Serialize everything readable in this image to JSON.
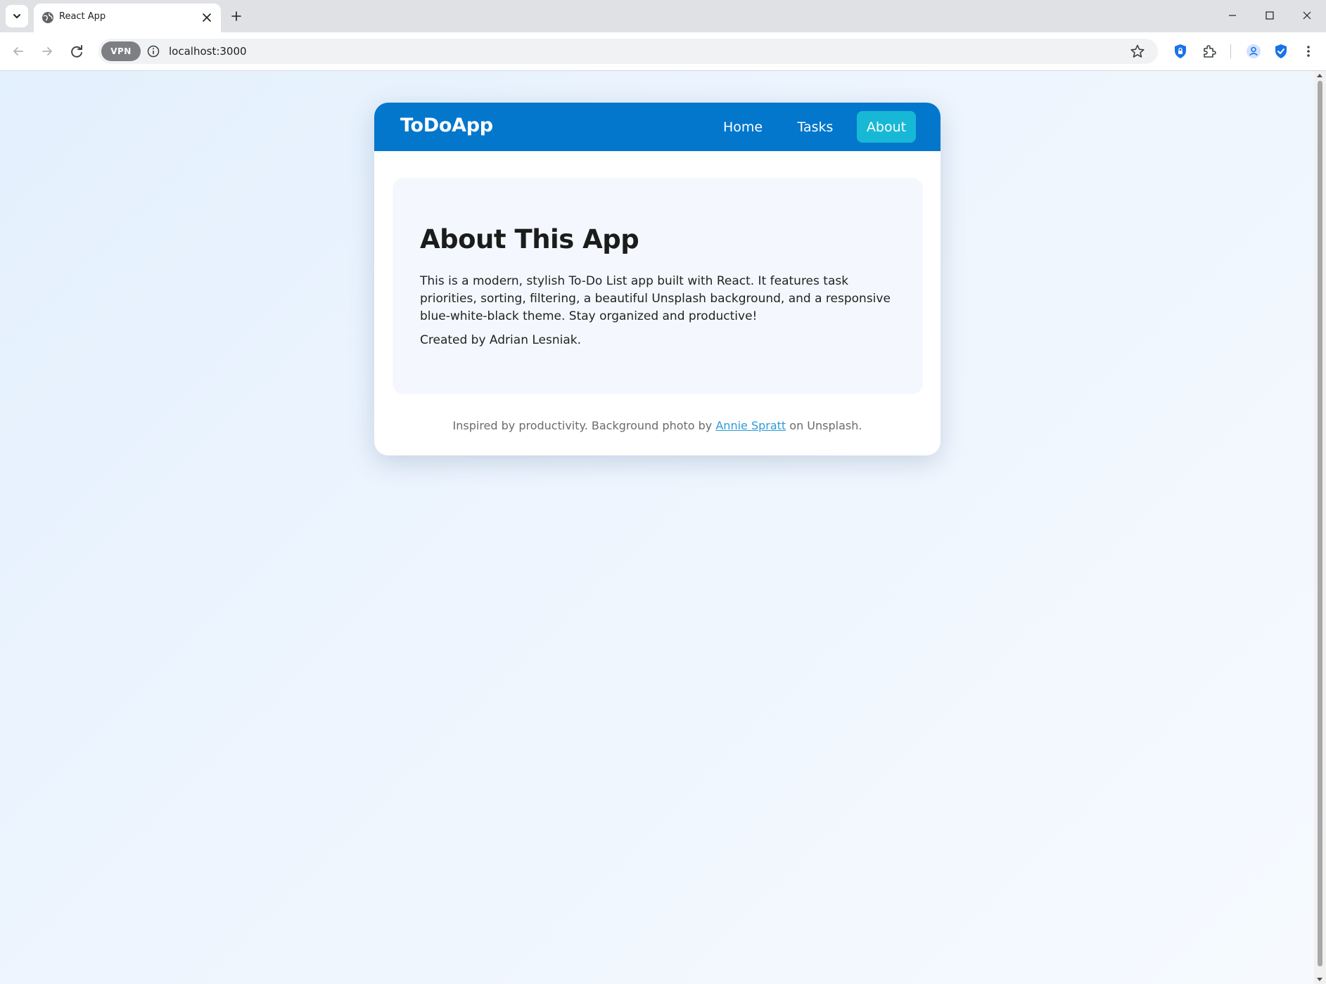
{
  "browser": {
    "tab": {
      "title": "React App",
      "favicon": "globe-icon"
    },
    "new_tab_icon": "plus-icon",
    "url": "localhost:3000",
    "vpn_label": "VPN",
    "icons": {
      "back": "arrow-left-icon",
      "forward": "arrow-right-icon",
      "reload": "reload-icon",
      "info": "info-icon",
      "bookmark": "star-icon",
      "shield_extension": "shield-lock-icon",
      "extensions": "puzzle-icon",
      "profile": "profile-icon",
      "security_extension": "shield-check-icon",
      "menu": "kebab-menu-icon",
      "minimize": "minimize-icon",
      "maximize": "maximize-icon",
      "close": "close-icon"
    }
  },
  "app": {
    "brand": "ToDoApp",
    "nav": [
      {
        "label": "Home",
        "active": false
      },
      {
        "label": "Tasks",
        "active": false
      },
      {
        "label": "About",
        "active": true
      }
    ],
    "about": {
      "title": "About This App",
      "description": "This is a modern, stylish To-Do List app built with React. It features task priorities, sorting, filtering, a beautiful Unsplash background, and a responsive blue-white-black theme. Stay organized and productive!",
      "credit": "Created by Adrian Lesniak."
    },
    "footer": {
      "prefix": "Inspired by productivity. Background photo by ",
      "link_text": "Annie Spratt",
      "suffix": " on Unsplash."
    }
  },
  "colors": {
    "navbar": "#0277cc",
    "active_nav": "#17b8d6",
    "link": "#2e9bd6",
    "panel": "#f4f8fe",
    "page_gradient_start": "#e3f0fd",
    "page_gradient_end": "#f6faff"
  }
}
